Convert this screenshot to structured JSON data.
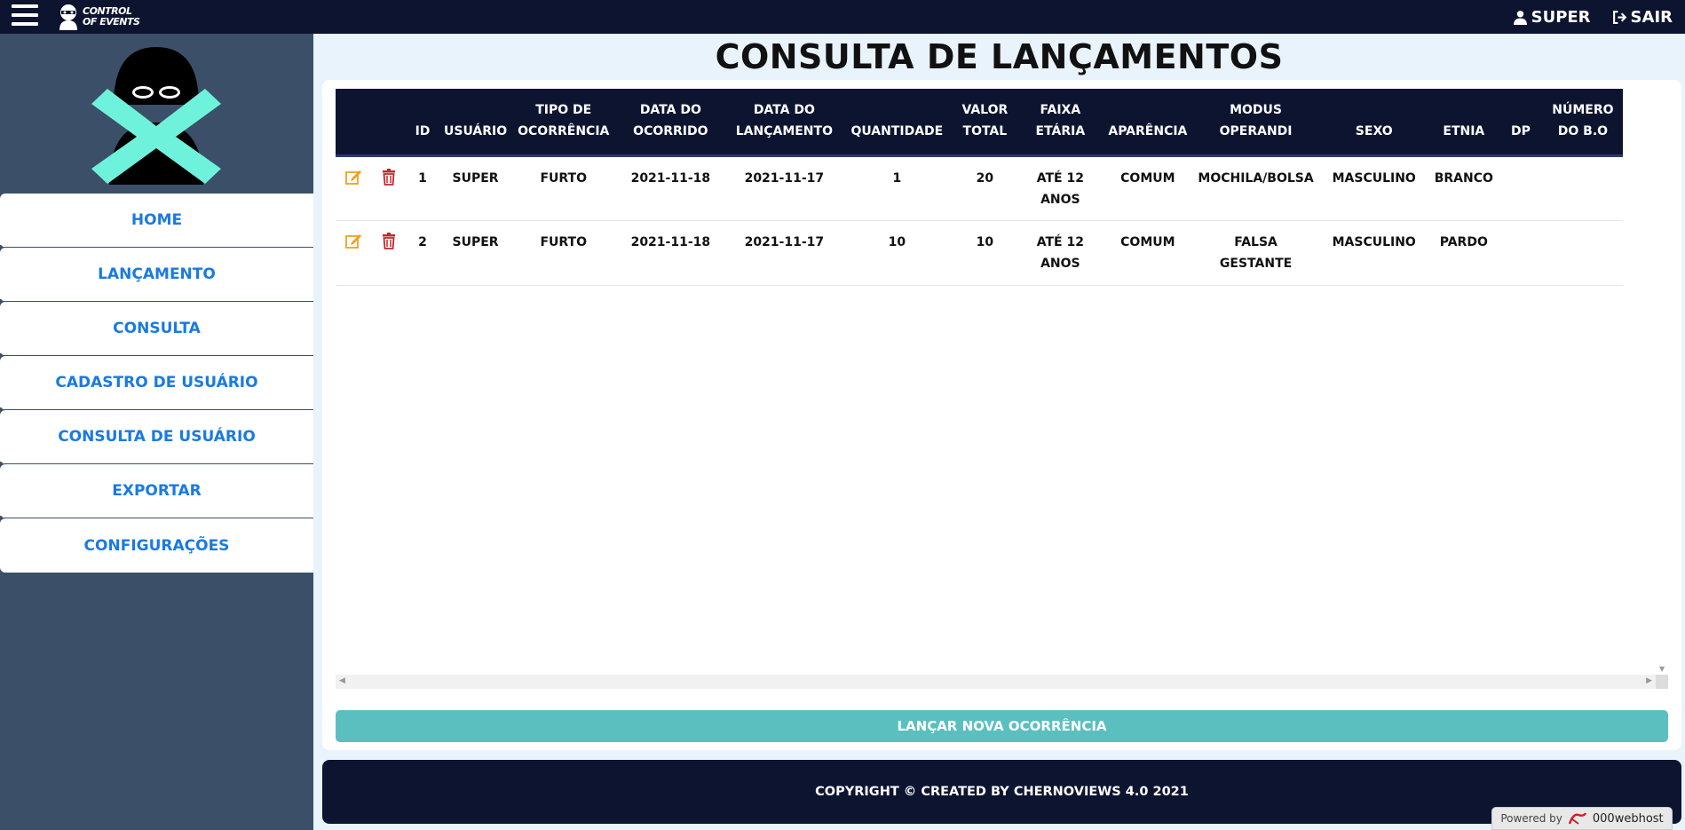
{
  "topbar": {
    "brand_line1": "CONTROL",
    "brand_line2": "OF EVENTS",
    "user_label": "SUPER",
    "logout_label": "SAIR"
  },
  "sidebar": {
    "items": [
      {
        "label": "HOME"
      },
      {
        "label": "LANÇAMENTO"
      },
      {
        "label": "CONSULTA"
      },
      {
        "label": "CADASTRO DE USUÁRIO"
      },
      {
        "label": "CONSULTA DE USUÁRIO"
      },
      {
        "label": "EXPORTAR"
      },
      {
        "label": "CONFIGURAÇÕES"
      }
    ]
  },
  "main": {
    "title": "CONSULTA DE LANÇAMENTOS",
    "table": {
      "headers": [
        "",
        "",
        "ID",
        "USUÁRIO",
        "TIPO DE OCORRÊNCIA",
        "DATA DO OCORRIDO",
        "DATA DO LANÇAMENTO",
        "QUANTIDADE",
        "VALOR TOTAL",
        "FAIXA ETÁRIA",
        "APARÊNCIA",
        "MODUS OPERANDI",
        "SEXO",
        "ETNIA",
        "DP",
        "NÚMERO DO B.O"
      ],
      "rows": [
        {
          "id": "1",
          "usuario": "SUPER",
          "tipo": "FURTO",
          "data_ocorrido": "2021-11-18",
          "data_lancamento": "2021-11-17",
          "quantidade": "1",
          "valor_total": "20",
          "faixa_etaria": "ATÉ 12 ANOS",
          "aparencia": "COMUM",
          "modus_operandi": "MOCHILA/BOLSA",
          "sexo": "MASCULINO",
          "etnia": "BRANCO",
          "dp": "",
          "numero_bo": ""
        },
        {
          "id": "2",
          "usuario": "SUPER",
          "tipo": "FURTO",
          "data_ocorrido": "2021-11-18",
          "data_lancamento": "2021-11-17",
          "quantidade": "10",
          "valor_total": "10",
          "faixa_etaria": "ATÉ 12 ANOS",
          "aparencia": "COMUM",
          "modus_operandi": "FALSA GESTANTE",
          "sexo": "MASCULINO",
          "etnia": "PARDO",
          "dp": "",
          "numero_bo": ""
        }
      ]
    },
    "new_button_label": "LANÇAR NOVA OCORRÊNCIA"
  },
  "footer": {
    "copyright": "COPYRIGHT © CREATED BY CHERNOVIEWS 4.0 2021",
    "powered_by": "Powered by",
    "host": "000webhost"
  },
  "colors": {
    "navbar": "#0c1430",
    "sidebar": "#3b5068",
    "nav_link": "#1a7ae2",
    "button": "#5cbfbf",
    "logo_x": "#6ff2dc",
    "edit_icon": "#f0a020",
    "delete_icon": "#c0282d"
  }
}
